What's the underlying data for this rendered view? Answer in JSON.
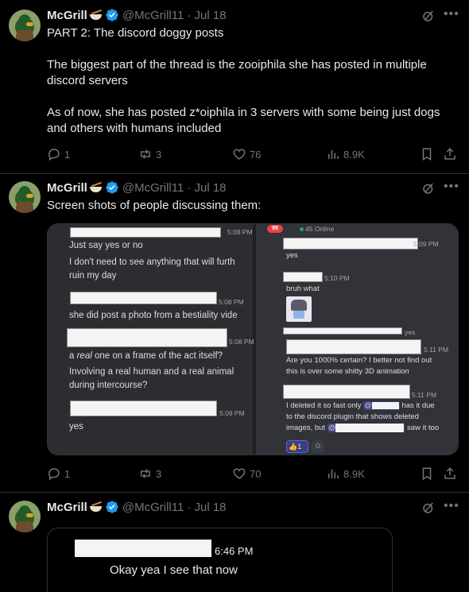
{
  "tweets": [
    {
      "name": "McGrill",
      "handle": "@McGrill11",
      "date": "· Jul 18",
      "text": "PART 2: The discord doggy posts\n\nThe biggest part of the thread is the zooiphila she has posted in multiple discord servers\n\nAs of now, she has posted z*oiphila in 3 servers with some being just dogs and others with humans included",
      "replies": "1",
      "reposts": "3",
      "likes": "76",
      "views": "8.9K"
    },
    {
      "name": "McGrill",
      "handle": "@McGrill11",
      "date": "· Jul 18",
      "text": "Screen shots of people discussing them:",
      "replies": "1",
      "reposts": "3",
      "likes": "70",
      "views": "8.9K"
    },
    {
      "name": "McGrill",
      "handle": "@McGrill11",
      "date": "· Jul 18"
    }
  ],
  "screenshot": {
    "left": {
      "t1": "5:08 PM",
      "m1": "Just say yes or no",
      "m2": "I don't need to see anything that will furth",
      "m3": "ruin my day",
      "t2": "5:08 PM",
      "m4": "she did post a photo from a bestiality vide",
      "t3": "5:08 PM",
      "m5a": "a ",
      "m5b": "real",
      "m5c": " one on a frame of the act itself?",
      "m6": "Involving a real human and a real animal",
      "m7": "during intercourse?",
      "t4": "5:09 PM",
      "m8": "yes"
    },
    "right": {
      "badge": "99",
      "online": "45 Online",
      "t1": "5:09 PM",
      "m1": "yes",
      "t2": "5:10 PM",
      "m2": "bruh what",
      "reply_yes": "yes",
      "t3": "5:11 PM",
      "m3": "Are you 1000% certain? I better not find out",
      "m4": "this is over some shitty 3D animation",
      "t4": "5:11 PM",
      "m5a": "I deleted it so fast only ",
      "m5b": " has it due",
      "m6": "to the discord plugin that shows deleted",
      "m7a": "images, but ",
      "m7b": " saw it too",
      "reaction_count": "1"
    }
  },
  "embed": {
    "time": "6:46 PM",
    "message": "Okay yea I see that now"
  }
}
